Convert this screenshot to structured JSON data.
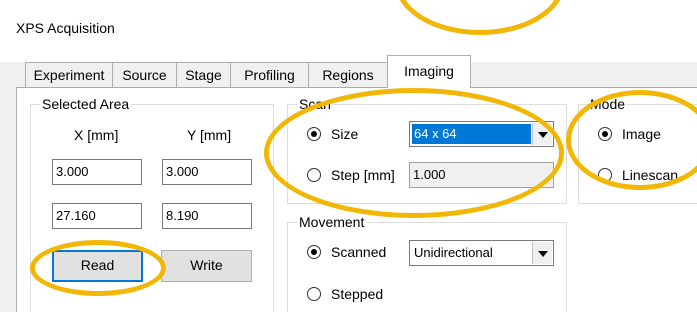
{
  "window": {
    "title": "XPS Acquisition"
  },
  "tabs": [
    {
      "label": "Experiment"
    },
    {
      "label": "Source"
    },
    {
      "label": "Stage"
    },
    {
      "label": "Profiling"
    },
    {
      "label": "Regions"
    },
    {
      "label": "Imaging",
      "active": true
    }
  ],
  "selected_area": {
    "group_label": "Selected Area",
    "x_header": "X [mm]",
    "y_header": "Y [mm]",
    "x1": "3.000",
    "y1": "3.000",
    "x2": "27.160",
    "y2": "8.190",
    "read_label": "Read",
    "write_label": "Write"
  },
  "scan": {
    "group_label": "Scan",
    "size_label": "Size",
    "size_selected": true,
    "size_value": "64 x 64",
    "step_label": "Step [mm]",
    "step_value": "1.000"
  },
  "mode": {
    "group_label": "Mode",
    "image_label": "Image",
    "image_selected": true,
    "linescan_label": "Linescan"
  },
  "movement": {
    "group_label": "Movement",
    "scanned_label": "Scanned",
    "scanned_selected": true,
    "direction_value": "Unidirectional",
    "stepped_label": "Stepped"
  },
  "colors": {
    "highlight_ellipse": "#f2b705",
    "selection_blue": "#0078d7"
  }
}
